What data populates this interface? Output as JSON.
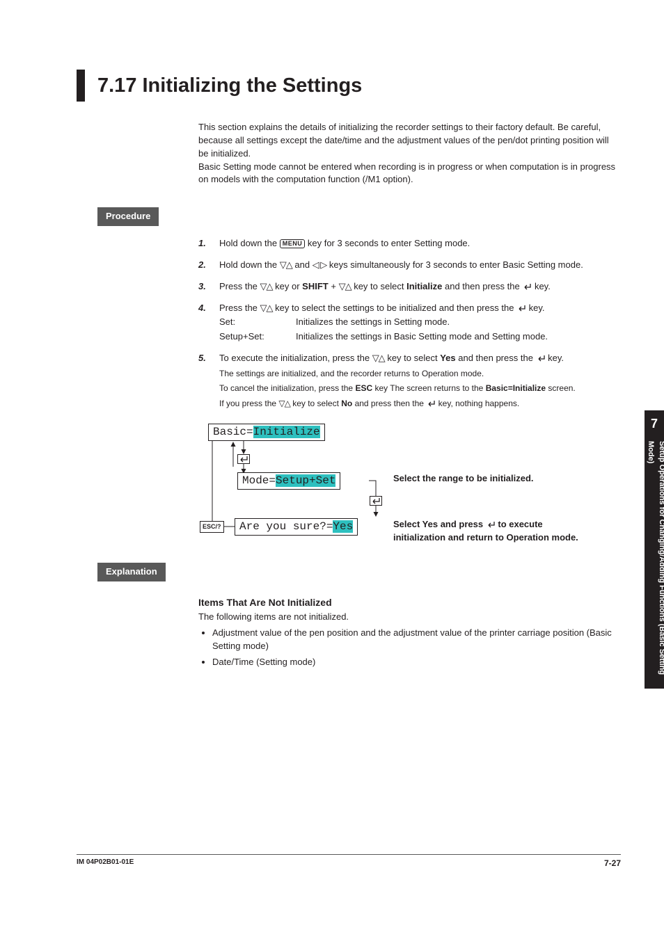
{
  "title": "7.17  Initializing the Settings",
  "intro": [
    "This section explains the details of initializing the recorder settings to their factory default. Be careful, because all settings except the date/time and the adjustment values of the pen/dot printing position will be initialized.",
    "Basic Setting mode cannot be entered when recording is in progress or when computation is in progress on models with the computation function (/M1 option)."
  ],
  "labels": {
    "procedure": "Procedure",
    "explanation": "Explanation"
  },
  "menu_key": "MENU",
  "esc_key": "ESC/?",
  "steps": {
    "s1": {
      "num": "1.",
      "a": "Hold down the ",
      "b": " key for 3 seconds to enter Setting mode."
    },
    "s2": {
      "num": "2.",
      "a": "Hold down the ",
      "b": " and ",
      "c": " keys simultaneously for 3 seconds to enter Basic Setting mode."
    },
    "s3": {
      "num": "3.",
      "a": "Press the ",
      "b": " key or ",
      "shift": "SHIFT",
      "c": " + ",
      "d": " key to select ",
      "target": "Initialize",
      "e": " and then press the ",
      "f": " key."
    },
    "s4": {
      "num": "4.",
      "a": "Press the ",
      "b": " key to select the settings to be initialized and then press the ",
      "c": " key.",
      "rows": [
        {
          "k": "Set:",
          "v": "Initializes the settings in Setting mode."
        },
        {
          "k": "Setup+Set:",
          "v": "Initializes the settings in Basic Setting mode and Setting mode."
        }
      ]
    },
    "s5": {
      "num": "5.",
      "a": "To execute the initialization, press the ",
      "b": " key to select ",
      "yes": "Yes",
      "c": " and then press the ",
      "d": " key.",
      "notes": [
        "The settings are initialized, and the recorder returns to Operation mode.",
        [
          "To cancel the initialization, press the ",
          "ESC",
          " key The screen returns to the ",
          "Basic=Initialize",
          " screen."
        ],
        [
          "If you press the ",
          " key to select ",
          "No",
          " and press then the ",
          " key, nothing happens."
        ]
      ]
    }
  },
  "diagram": {
    "lcd1_a": "Basic=",
    "lcd1_b": "Initialize",
    "lcd2_a": "Mode=",
    "lcd2_b": "Setup+Set",
    "lcd3_a": "Are you sure?=",
    "lcd3_b": "Yes",
    "cap1": "Select the range to be initialized.",
    "cap2_a": "Select Yes and press ",
    "cap2_b": " to execute initialization and return to Operation mode."
  },
  "explanation": {
    "head": "Items That Are Not Initialized",
    "lead": "The following items are not initialized.",
    "items": [
      "Adjustment value of the pen position and the adjustment value of the printer carriage position (Basic Setting mode)",
      "Date/Time (Setting mode)"
    ]
  },
  "side": {
    "chapter": "7",
    "text": "Setup Operations for Changing/Adding Functions (Basic Setting Mode)"
  },
  "footer": {
    "doc": "IM 04P02B01-01E",
    "page": "7-27"
  }
}
